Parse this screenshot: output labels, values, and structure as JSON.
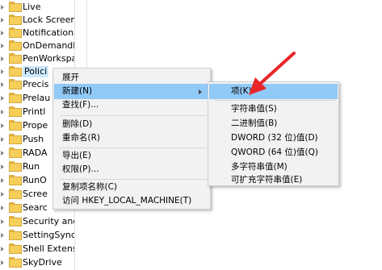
{
  "tree": {
    "items": [
      {
        "label": "Live"
      },
      {
        "label": "Lock Screen"
      },
      {
        "label": "Notifications"
      },
      {
        "label": "OnDemandInt"
      },
      {
        "label": "PenWorkspac"
      },
      {
        "label": "Polici"
      },
      {
        "label": "Precis"
      },
      {
        "label": "Prelau"
      },
      {
        "label": "Printl"
      },
      {
        "label": "Prope"
      },
      {
        "label": "Push"
      },
      {
        "label": "RADA"
      },
      {
        "label": "Run"
      },
      {
        "label": "RunO"
      },
      {
        "label": "Scree"
      },
      {
        "label": "Searc"
      },
      {
        "label": "Security and"
      },
      {
        "label": "SettingSync"
      },
      {
        "label": "Shell Extensio"
      },
      {
        "label": "SkyDrive"
      }
    ]
  },
  "context_menu": {
    "items": [
      {
        "label": "展开"
      },
      {
        "label": "新建(N)"
      },
      {
        "label": "查找(F)..."
      },
      {
        "label": "删除(D)"
      },
      {
        "label": "重命名(R)"
      },
      {
        "label": "导出(E)"
      },
      {
        "label": "权限(P)..."
      },
      {
        "label": "复制项名称(C)"
      },
      {
        "label": "访问 HKEY_LOCAL_MACHINE(T)"
      }
    ]
  },
  "submenu": {
    "items": [
      {
        "label": "项(K)"
      },
      {
        "label": "字符串值(S)"
      },
      {
        "label": "二进制值(B)"
      },
      {
        "label": "DWORD (32 位)值(D)"
      },
      {
        "label": "QWORD (64 位)值(Q)"
      },
      {
        "label": "多字符串值(M)"
      },
      {
        "label": "可扩充字符串值(E)"
      }
    ]
  },
  "colors": {
    "highlight": "#91c9f7",
    "annotation_arrow": "#e8262a",
    "folder": "#f5cf5a"
  }
}
